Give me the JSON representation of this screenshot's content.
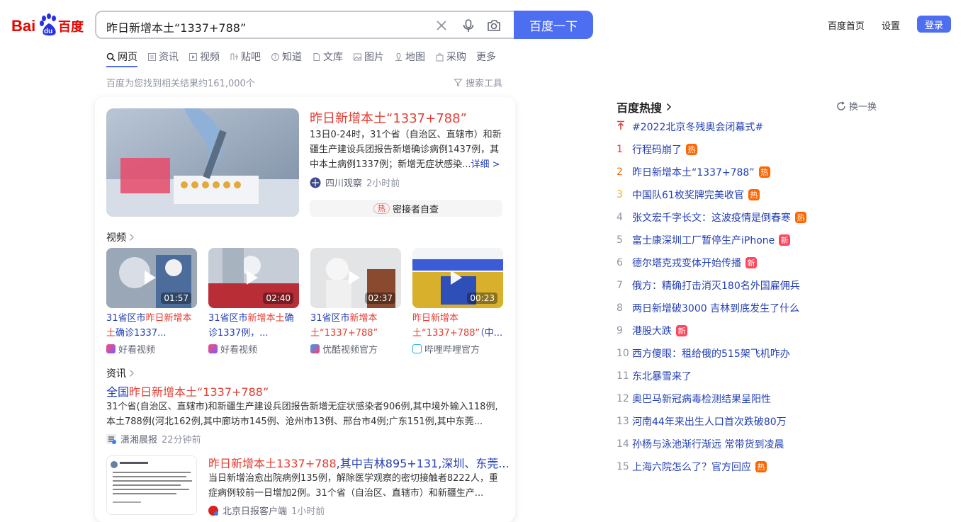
{
  "header": {
    "logo_text": "Bai百度",
    "search_value": "昨日新增本土“1337+788”",
    "search_button": "百度一下",
    "home_link": "百度首页",
    "settings_link": "设置",
    "login_button": "登录",
    "accent_color": "#4e6ef2"
  },
  "tabs": [
    "网页",
    "资讯",
    "视频",
    "贴吧",
    "知道",
    "文库",
    "图片",
    "地图",
    "采购",
    "更多"
  ],
  "results_count": "百度为您找到相关结果约161,000个",
  "search_tools": "搜索工具",
  "top_result": {
    "title": "昨日新增本土“1337+788”",
    "snippet": "13日0-24时，31个省（自治区、直辖市）和新疆生产建设兵团报告新增确诊病例1437例，其中本土病例1337例；新增无症状感染...",
    "detail_link": "详细 >",
    "source": "四川观察",
    "time": "2小时前",
    "hot_badge": "热",
    "hot_pill_text": "密接者自查"
  },
  "video_section": {
    "label": "视频",
    "videos": [
      {
        "duration": "01:57",
        "title_a": "31省区市",
        "title_b": "昨日新增本土",
        "title_c": "确诊1337...",
        "source": "好看视频"
      },
      {
        "duration": "02:40",
        "title_a": "31省区市",
        "title_b": "新增本土",
        "title_c": "确诊1337例，...",
        "source": "好看视频"
      },
      {
        "duration": "02:37",
        "title_a": "31省区市",
        "title_b": "新增本土“1337+788”",
        "title_c": "",
        "source": "优酷视频官方"
      },
      {
        "duration": "00:23",
        "title_a": "",
        "title_b": "昨日新增本土“1337+788”",
        "title_c": "（中...",
        "source": "哔哩哔哩官方"
      }
    ]
  },
  "news_section": {
    "label": "资讯",
    "item1": {
      "title_a": "全国",
      "title_b": "昨日新增本土“1337+788”",
      "snippet": "31个省(自治区、直辖市)和新疆生产建设兵团报告新增无症状感染者906例,其中境外输入118例,本土788例(河北162例,其中廊坊市145例、沧州市13例、邢台市4例;广东151例,其中东莞...",
      "source": "潇湘晨报",
      "time": "22分钟前"
    },
    "item2": {
      "title_a": "昨日新增本土1337+788",
      "title_b": ",其中吉林895+131,深圳、东莞...",
      "snippet": "当日新增治愈出院病例135例，解除医学观察的密切接触者8222人，重症病例较前一日增加2例。31个省（自治区、直辖市）和新疆生产...",
      "source": "北京日报客户端",
      "time": "1小时前"
    }
  },
  "hot_list": {
    "title": "百度热搜",
    "refresh": "换一换",
    "pinned": "#2022北京冬残奥会闭幕式#",
    "items": [
      {
        "rank": "1",
        "text": "行程码崩了",
        "badge": "热"
      },
      {
        "rank": "2",
        "text": "昨日新增本土“1337+788”",
        "badge": "热"
      },
      {
        "rank": "3",
        "text": "中国队61枚奖牌完美收官",
        "badge": "热"
      },
      {
        "rank": "4",
        "text": "张文宏千字长文：这波疫情是倒春寒",
        "badge": "热"
      },
      {
        "rank": "5",
        "text": "富士康深圳工厂暂停生产iPhone",
        "badge": "新"
      },
      {
        "rank": "6",
        "text": "德尔塔克戎变体开始传播",
        "badge": "新"
      },
      {
        "rank": "7",
        "text": "俄方：精确打击消灭180名外国雇佣兵",
        "badge": ""
      },
      {
        "rank": "8",
        "text": "两日新增破3000 吉林到底发生了什么",
        "badge": ""
      },
      {
        "rank": "9",
        "text": "港股大跌",
        "badge": "新"
      },
      {
        "rank": "10",
        "text": "西方傻眼：租给俄的515架飞机咋办",
        "badge": ""
      },
      {
        "rank": "11",
        "text": "东北暴雪来了",
        "badge": ""
      },
      {
        "rank": "12",
        "text": "奥巴马新冠病毒检测结果呈阳性",
        "badge": ""
      },
      {
        "rank": "13",
        "text": "河南44年来出生人口首次跌破80万",
        "badge": ""
      },
      {
        "rank": "14",
        "text": "孙杨与泳池渐行渐远 常带货到凌晨",
        "badge": ""
      },
      {
        "rank": "15",
        "text": "上海六院怎么了？官方回应",
        "badge": "热"
      }
    ]
  }
}
